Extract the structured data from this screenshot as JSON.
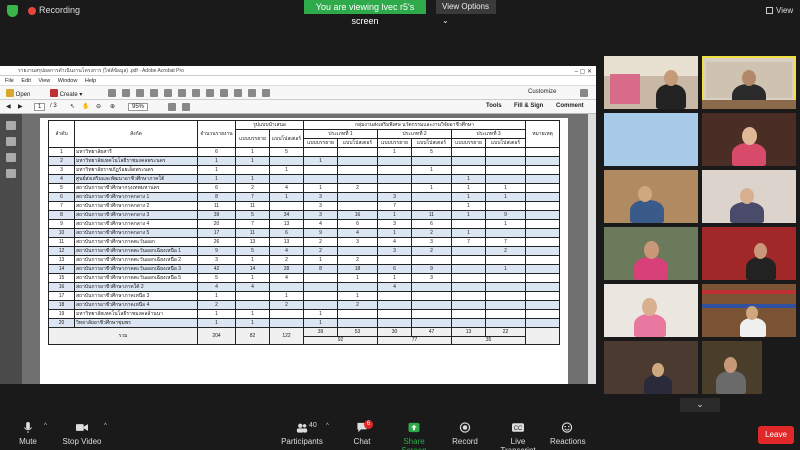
{
  "zoom": {
    "recording": "Recording",
    "viewing_banner": "You are viewing lvec r5's screen",
    "view_options": "View Options ⌄",
    "view": "View",
    "participants_count": "40",
    "chat_badge": "6"
  },
  "acrobat": {
    "title": "รายงานสรุปผลการดำเนินงานโครงการ (ไฟล์ข้อมูล) .pdf - Adobe Acrobat Pro",
    "menu": [
      "File",
      "Edit",
      "View",
      "Window",
      "Help"
    ],
    "open": "Open",
    "create": "Create",
    "customize": "Customize",
    "page_current": "1",
    "page_total": "/ 3",
    "zoom_value": "95%",
    "tools": "Tools",
    "fill_sign": "Fill & Sign",
    "comment": "Comment"
  },
  "table": {
    "h_no": "ลำดับ",
    "h_name": "สังกัด",
    "h_total": "จำนวนรายงาน",
    "h_format": "รูปแบบนำเสนอ",
    "h_fmt1": "แบบบรรยาย",
    "h_fmt2": "แบบโปสเตอร์",
    "h_group": "กลุ่มงานส่งเสริมพิเศษ นวัตกรรมและงานวิจัยอาชีวศึกษา",
    "h_t1": "ประเภทที่ 1",
    "h_t2": "ประเภทที่ 2",
    "h_t3": "ประเภทที่ 3",
    "h_note": "หมายเหตุ",
    "rows": [
      [
        "1",
        "มหาวิทยาลัยสารี",
        "6",
        "1",
        "5",
        "",
        "",
        "1",
        "5",
        "",
        ""
      ],
      [
        "2",
        "มหาวิทยาลัยเทคโนโลยีราชมงคลพระนคร",
        "1",
        "1",
        "",
        "1",
        "",
        "",
        "",
        "",
        ""
      ],
      [
        "3",
        "มหาวิทยาลัยราชภัฏร้อยเอ็ดพระนคร",
        "1",
        "",
        "1",
        "",
        "",
        "",
        "1",
        "",
        ""
      ],
      [
        "4",
        "ศูนย์ส่งเสริมและพัฒนาอาชีวศึกษาภาคใต้",
        "1",
        "1",
        "",
        "",
        "",
        "",
        "",
        "1",
        ""
      ],
      [
        "5",
        "สถาบันการอาชีวศึกษากรุงเทพมหานคร",
        "6",
        "2",
        "4",
        "1",
        "2",
        "",
        "1",
        "1",
        "1"
      ],
      [
        "6",
        "สถาบันการอาชีวศึกษาภาคกลาง 1",
        "8",
        "7",
        "1",
        "3",
        "",
        "3",
        "",
        "1",
        "1"
      ],
      [
        "7",
        "สถาบันการอาชีวศึกษาภาคกลาง 2",
        "11",
        "11",
        "",
        "3",
        "",
        "7",
        "",
        "1",
        ""
      ],
      [
        "8",
        "สถาบันการอาชีวศึกษาภาคกลาง 3",
        "39",
        "5",
        "34",
        "3",
        "16",
        "1",
        "11",
        "1",
        "9"
      ],
      [
        "9",
        "สถาบันการอาชีวศึกษาภาคกลาง 4",
        "20",
        "7",
        "13",
        "4",
        "6",
        "3",
        "6",
        "",
        "1"
      ],
      [
        "10",
        "สถาบันการอาชีวศึกษาภาคกลาง 5",
        "17",
        "11",
        "6",
        "9",
        "4",
        "1",
        "2",
        "1",
        ""
      ],
      [
        "11",
        "สถาบันการอาชีวศึกษาภาคตะวันออก",
        "26",
        "13",
        "13",
        "2",
        "3",
        "4",
        "3",
        "7",
        "7"
      ],
      [
        "12",
        "สถาบันการอาชีวศึกษาภาคตะวันออกเฉียงเหนือ 1",
        "9",
        "5",
        "4",
        "2",
        "",
        "3",
        "2",
        "",
        "2"
      ],
      [
        "13",
        "สถาบันการอาชีวศึกษาภาคตะวันออกเฉียงเหนือ 2",
        "3",
        "1",
        "2",
        "1",
        "2",
        "",
        "",
        "",
        ""
      ],
      [
        "14",
        "สถาบันการอาชีวศึกษาภาคตะวันออกเฉียงเหนือ 3",
        "42",
        "14",
        "28",
        "8",
        "18",
        "6",
        "9",
        "",
        "1"
      ],
      [
        "15",
        "สถาบันการอาชีวศึกษาภาคตะวันออกเฉียงเหนือ 5",
        "5",
        "1",
        "4",
        "",
        "1",
        "1",
        "3",
        "",
        ""
      ],
      [
        "16",
        "สถาบันการอาชีวศึกษาภาคใต้ 2",
        "4",
        "4",
        "",
        "",
        "",
        "4",
        "",
        "",
        ""
      ],
      [
        "17",
        "สถาบันการอาชีวศึกษาภาคเหนือ 3",
        "1",
        "",
        "1",
        "",
        "1",
        "",
        "",
        "",
        ""
      ],
      [
        "18",
        "สถาบันการอาชีวศึกษาภาคเหนือ 4",
        "2",
        "",
        "2",
        "",
        "2",
        "",
        "",
        "",
        ""
      ],
      [
        "19",
        "มหาวิทยาลัยเทคโนโลยีราชมงคลล้านนา",
        "1",
        "1",
        "",
        "1",
        "",
        "",
        "",
        "",
        ""
      ],
      [
        "20",
        "วิทยาลัยอาชีวศึกษาชุมพร",
        "1",
        "1",
        "",
        "1",
        "",
        "",
        "",
        "",
        ""
      ]
    ],
    "total_label": "รวม",
    "totals": [
      "204",
      "82",
      "122"
    ],
    "sub": [
      "39",
      "53",
      "30",
      "47",
      "13",
      "22"
    ],
    "grand": [
      "92",
      "77",
      "35"
    ]
  },
  "controls": {
    "mute": "Mute",
    "stop_video": "Stop Video",
    "participants": "Participants",
    "chat": "Chat",
    "share_screen": "Share Screen",
    "record": "Record",
    "live_transcript": "Live Transcript",
    "reactions": "Reactions",
    "leave": "Leave"
  }
}
